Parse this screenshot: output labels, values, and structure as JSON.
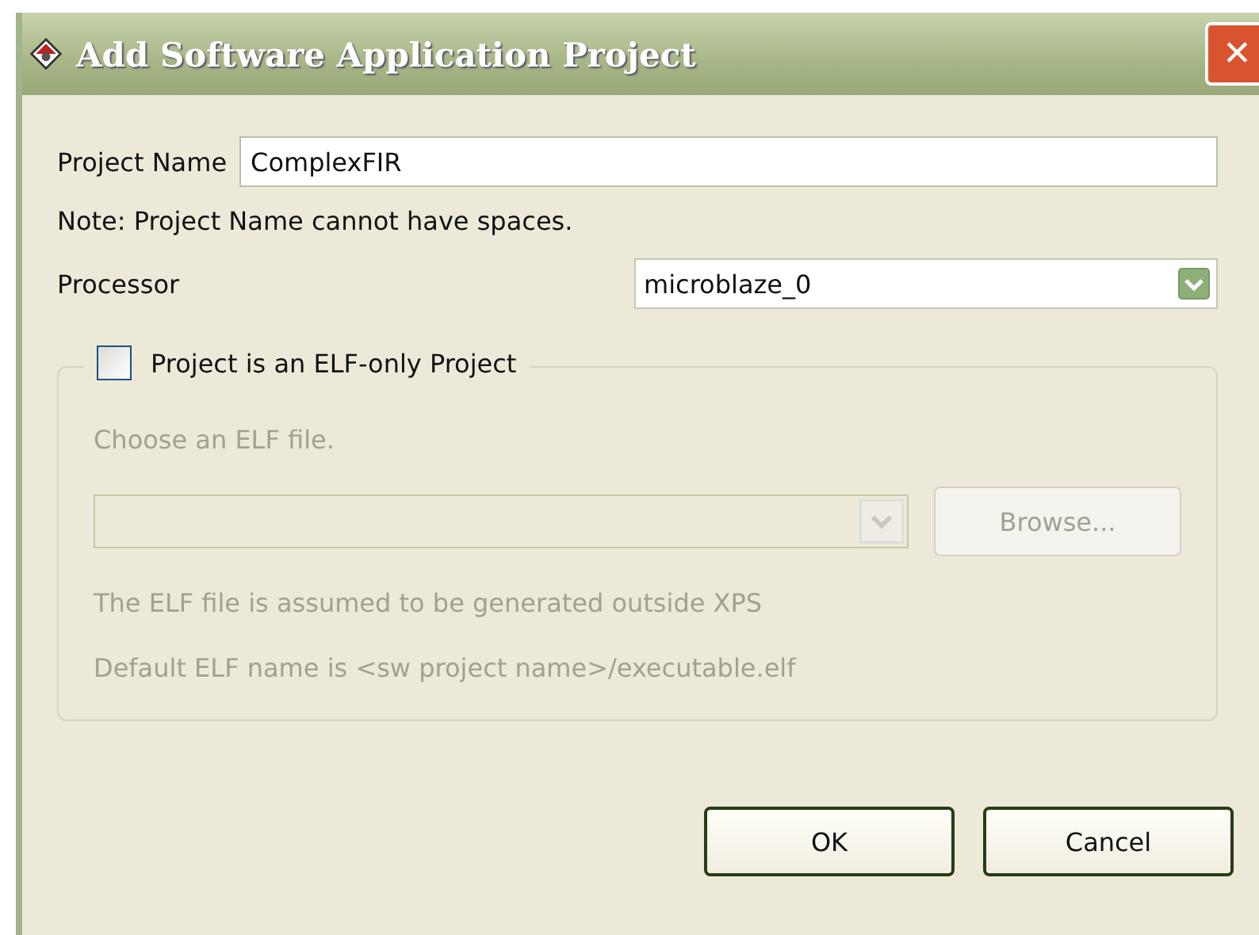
{
  "window": {
    "title": "Add Software Application Project",
    "close": "✕"
  },
  "project_name": {
    "label": "Project Name",
    "value": "ComplexFIR"
  },
  "note": "Note: Project Name cannot have spaces.",
  "processor": {
    "label": "Processor",
    "value": "microblaze_0"
  },
  "elf_group": {
    "checkbox": {
      "label": "Project is an ELF-only Project",
      "checked": false
    },
    "disabled": true,
    "choose_label": "Choose an ELF file.",
    "browse": "Browse...",
    "notes": [
      "The ELF file is assumed to be generated outside XPS",
      "Default ELF name is <sw project name>/executable.elf"
    ]
  },
  "buttons": [
    "OK",
    "Cancel"
  ]
}
